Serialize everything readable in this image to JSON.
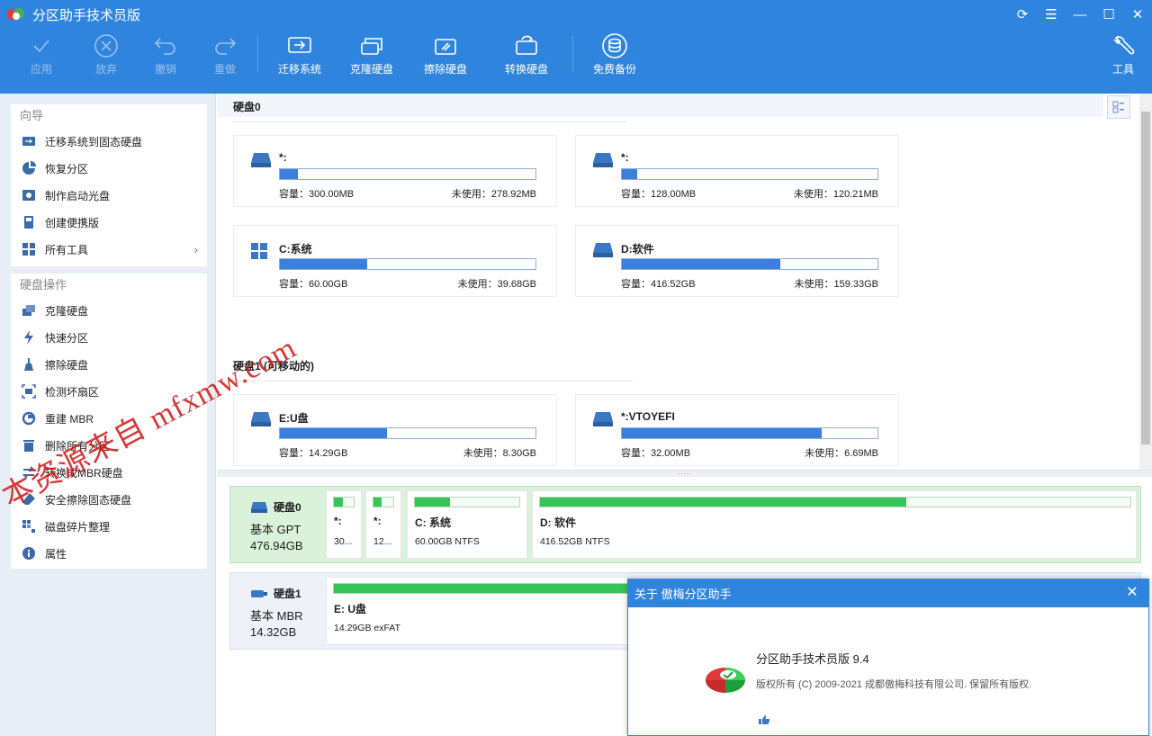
{
  "window": {
    "title": "分区助手技术员版",
    "controls": [
      "refresh-icon",
      "menu-icon",
      "minimize-icon",
      "maximize-icon",
      "close-icon"
    ]
  },
  "toolbar": {
    "apply": "应用",
    "discard": "放弃",
    "undo": "撤销",
    "redo": "重做",
    "migrate": "迁移系统",
    "clone": "克隆硬盘",
    "wipe": "擦除硬盘",
    "convert": "转换硬盘",
    "backup": "免费备份",
    "tools": "工具"
  },
  "sidebar": {
    "wizard_title": "向导",
    "wizard_items": [
      {
        "label": "迁移系统到固态硬盘",
        "icon": "migrate-icon"
      },
      {
        "label": "恢复分区",
        "icon": "restore-icon"
      },
      {
        "label": "制作启动光盘",
        "icon": "bootdisk-icon"
      },
      {
        "label": "创建便携版",
        "icon": "portable-icon"
      },
      {
        "label": "所有工具",
        "icon": "tools-icon"
      }
    ],
    "disk_ops_title": "硬盘操作",
    "disk_items": [
      {
        "label": "克隆硬盘",
        "icon": "clone-icon"
      },
      {
        "label": "快速分区",
        "icon": "lightning-icon"
      },
      {
        "label": "擦除硬盘",
        "icon": "broom-icon"
      },
      {
        "label": "检测坏扇区",
        "icon": "scan-icon"
      },
      {
        "label": "重建 MBR",
        "icon": "rebuild-icon"
      },
      {
        "label": "删除所有分区",
        "icon": "trash-icon"
      },
      {
        "label": "转换成MBR硬盘",
        "icon": "convert-icon"
      },
      {
        "label": "安全擦除固态硬盘",
        "icon": "eraser-icon"
      },
      {
        "label": "磁盘碎片整理",
        "icon": "defrag-icon"
      },
      {
        "label": "属性",
        "icon": "info-icon"
      }
    ]
  },
  "disk0": {
    "title": "硬盘0",
    "partitions": [
      {
        "name": "*:",
        "cap": "容量：300.00MB",
        "free": "未使用：278.92MB",
        "used_pct": 7,
        "icon": "drive-icon"
      },
      {
        "name": "*:",
        "cap": "容量：128.00MB",
        "free": "未使用：120.21MB",
        "used_pct": 6,
        "icon": "drive-icon"
      },
      {
        "name": "C:系统",
        "cap": "容量：60.00GB",
        "free": "未使用：39.68GB",
        "used_pct": 34,
        "icon": "windows-icon"
      },
      {
        "name": "D:软件",
        "cap": "容量：416.52GB",
        "free": "未使用：159.33GB",
        "used_pct": 62,
        "icon": "drive-icon"
      }
    ]
  },
  "disk1": {
    "title": "硬盘1 (可移动的)",
    "partitions": [
      {
        "name": "E:U盘",
        "cap": "容量：14.29GB",
        "free": "未使用：8.30GB",
        "used_pct": 42,
        "icon": "drive-icon"
      },
      {
        "name": "*:VTOYEFI",
        "cap": "容量：32.00MB",
        "free": "未使用：6.69MB",
        "used_pct": 78,
        "icon": "drive-icon"
      }
    ]
  },
  "diskmap": {
    "disk0": {
      "name": "硬盘0",
      "type": "基本 GPT",
      "size": "476.94GB",
      "parts": [
        {
          "name": "*:",
          "info": "30...",
          "used_pct": 45
        },
        {
          "name": "*:",
          "info": "12...",
          "used_pct": 40
        },
        {
          "name": "C: 系统",
          "info": "60.00GB NTFS",
          "used_pct": 34
        },
        {
          "name": "D: 软件",
          "info": "416.52GB NTFS",
          "used_pct": 62
        }
      ]
    },
    "disk1": {
      "name": "硬盘1",
      "type": "基本 MBR",
      "size": "14.32GB",
      "parts": [
        {
          "name": "E: U盘",
          "info": "14.29GB exFAT",
          "used_pct": 100
        }
      ]
    }
  },
  "about": {
    "title": "关于 傲梅分区助手",
    "product": "分区助手技术员版 9.4",
    "copyright": "版权所有 (C) 2009-2021 成都傲梅科技有限公司. 保留所有版权."
  },
  "watermark": "本资源来自 mfxmw.com",
  "colors": {
    "titlebar": "#2f84dd",
    "bar_blue": "#3a7fde",
    "bar_green": "#37c45a",
    "selected_row": "#d9f2d9"
  }
}
